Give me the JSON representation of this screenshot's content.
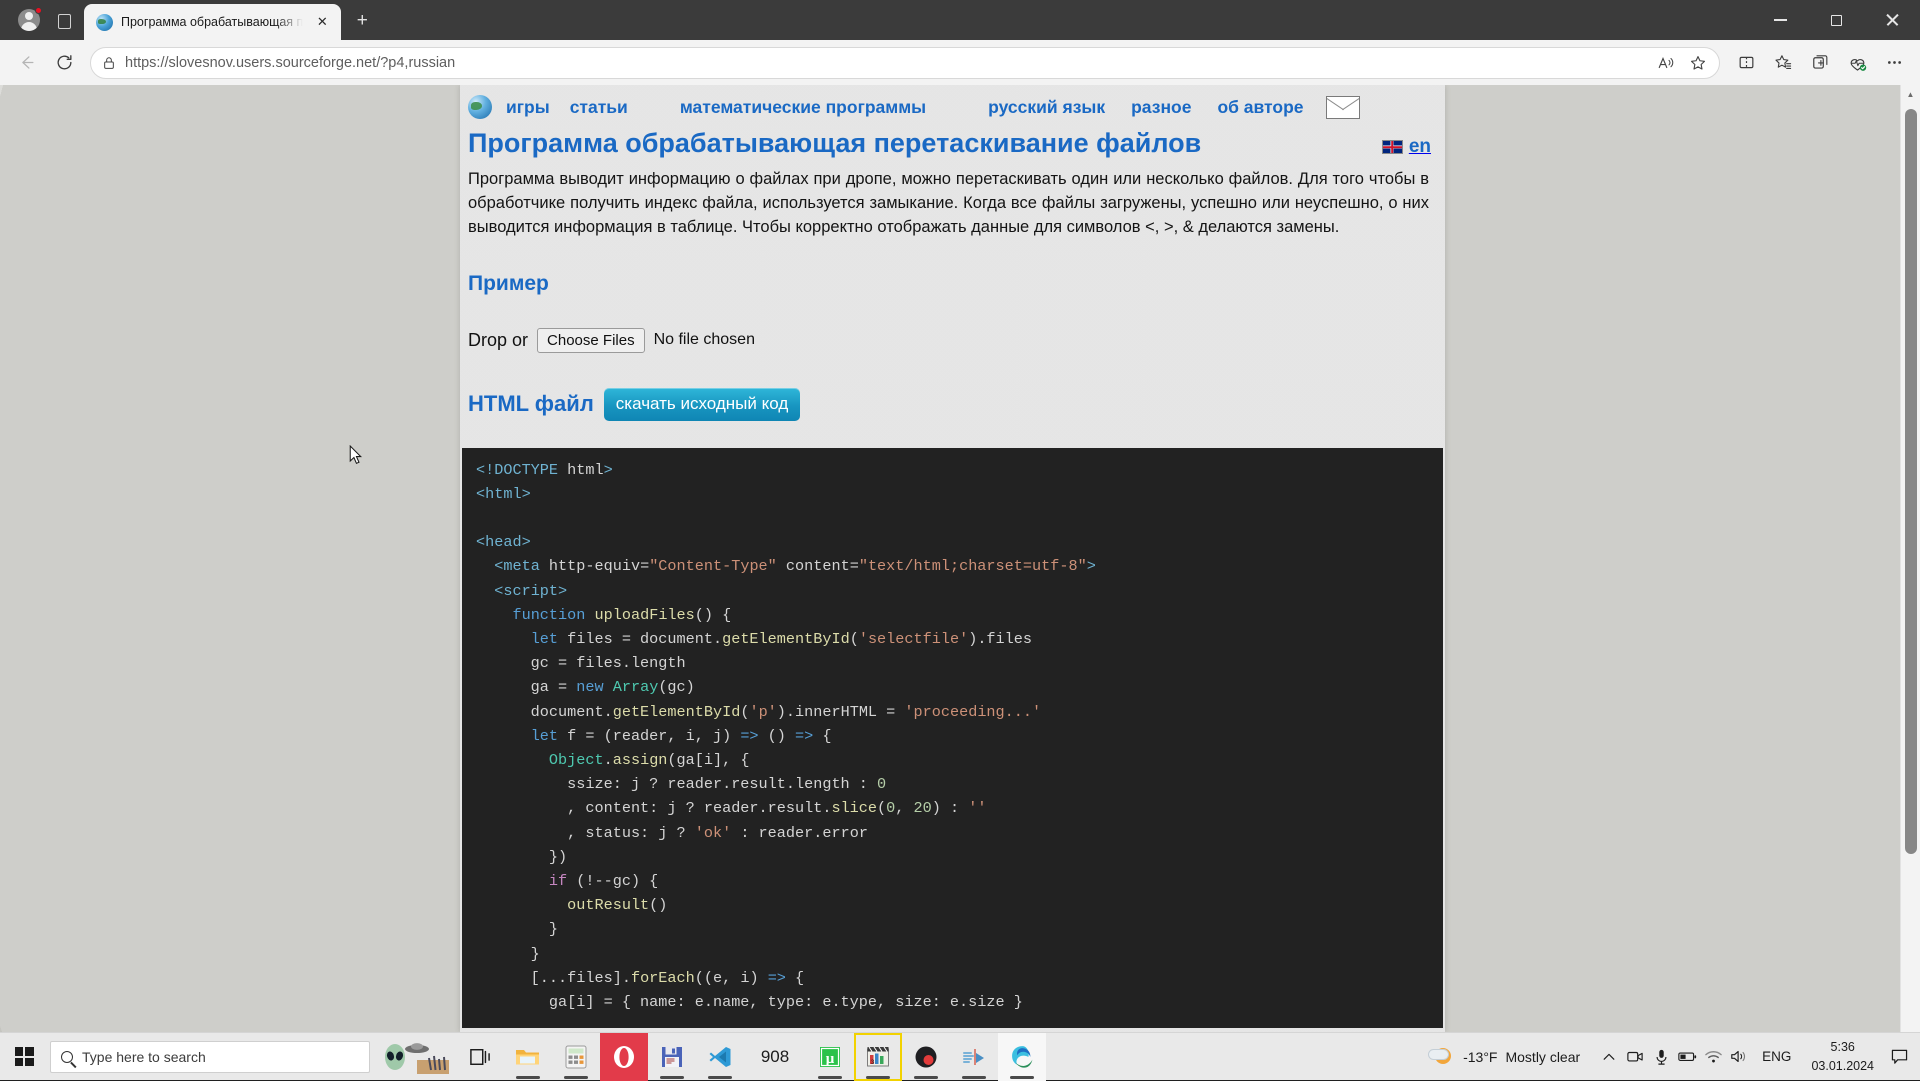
{
  "browser": {
    "tab": {
      "title": "Программа обрабатывающая п",
      "close_label": "✕"
    },
    "newtab_label": "+",
    "url": "https://slovesnov.users.sourceforge.net/?p4,russian",
    "toolbar_icons": {
      "back": "back-arrow-icon",
      "refresh": "refresh-icon",
      "lock": "site-info-lock-icon",
      "read_aloud": "read-aloud-icon",
      "favorite": "add-favorite-star-icon",
      "split_screen": "split-screen-icon",
      "collections_star": "favorites-list-icon",
      "add_collection": "collections-icon",
      "browser_essentials": "browser-essentials-icon",
      "settings": "settings-more-icon"
    },
    "window_controls": {
      "minimize": "minimize",
      "maximize": "maximize",
      "close": "close"
    }
  },
  "page": {
    "nav": [
      {
        "label": "игры",
        "name": "nav-link-games"
      },
      {
        "label": "статьи",
        "name": "nav-link-articles"
      },
      {
        "label": "математические программы",
        "name": "nav-link-math-programs"
      },
      {
        "label": "русский язык",
        "name": "nav-link-russian"
      },
      {
        "label": "разное",
        "name": "nav-link-misc"
      },
      {
        "label": "об авторе",
        "name": "nav-link-about-author"
      }
    ],
    "title": "Программа обрабатывающая перетаскивание файлов",
    "lang_switch": "en",
    "paragraph": "Программа выводит информацию о файлах при дропе, можно перетаскивать один или несколько файлов. Для того чтобы в обработчике получить индекс файла, используется замыкание. Когда все файлы загружены, успешно или неуспешно, о них выводится информация в таблице. Чтобы корректно отображать данные для символов <, >, & делаются замены.",
    "example_heading": "Пример",
    "drop_label": "Drop or",
    "file_button": "Choose Files",
    "file_status": "No file chosen",
    "html_label": "HTML файл",
    "download_button": "скачать исходный код",
    "accent_color": "#1a69c4",
    "download_button_color": "#1895c0"
  },
  "code": {
    "lines": [
      [
        [
          "tok-tag",
          "<!DOCTYPE"
        ],
        [
          "tok-plain",
          " html"
        ],
        [
          "tok-tag",
          ">"
        ]
      ],
      [
        [
          "tok-tag",
          "<html>"
        ]
      ],
      [
        [
          "tok-plain",
          ""
        ]
      ],
      [
        [
          "tok-tag",
          "<head>"
        ]
      ],
      [
        [
          "tok-plain",
          "  "
        ],
        [
          "tok-tag",
          "<meta"
        ],
        [
          "tok-plain",
          " http-equiv="
        ],
        [
          "tok-str",
          "\"Content-Type\""
        ],
        [
          "tok-plain",
          " content="
        ],
        [
          "tok-str",
          "\"text/html;charset=utf-8\""
        ],
        [
          "tok-tag",
          ">"
        ]
      ],
      [
        [
          "tok-plain",
          "  "
        ],
        [
          "tok-tag",
          "<script>"
        ]
      ],
      [
        [
          "tok-plain",
          "    "
        ],
        [
          "tok-kw",
          "function"
        ],
        [
          "tok-plain",
          " "
        ],
        [
          "tok-fn",
          "uploadFiles"
        ],
        [
          "tok-plain",
          "() {"
        ]
      ],
      [
        [
          "tok-plain",
          "      "
        ],
        [
          "tok-kw",
          "let"
        ],
        [
          "tok-plain",
          " files = document."
        ],
        [
          "tok-fn",
          "getElementById"
        ],
        [
          "tok-plain",
          "("
        ],
        [
          "tok-str",
          "'selectfile'"
        ],
        [
          "tok-plain",
          ").files"
        ]
      ],
      [
        [
          "tok-plain",
          "      gc = files.length"
        ]
      ],
      [
        [
          "tok-plain",
          "      ga = "
        ],
        [
          "tok-kw",
          "new"
        ],
        [
          "tok-plain",
          " "
        ],
        [
          "tok-cls",
          "Array"
        ],
        [
          "tok-plain",
          "(gc)"
        ]
      ],
      [
        [
          "tok-plain",
          "      document."
        ],
        [
          "tok-fn",
          "getElementById"
        ],
        [
          "tok-plain",
          "("
        ],
        [
          "tok-str",
          "'p'"
        ],
        [
          "tok-plain",
          ").innerHTML = "
        ],
        [
          "tok-str",
          "'proceeding...'"
        ]
      ],
      [
        [
          "tok-plain",
          "      "
        ],
        [
          "tok-kw",
          "let"
        ],
        [
          "tok-plain",
          " f = (reader, i, j) "
        ],
        [
          "tok-kw",
          "=>"
        ],
        [
          "tok-plain",
          " () "
        ],
        [
          "tok-kw",
          "=>"
        ],
        [
          "tok-plain",
          " {"
        ]
      ],
      [
        [
          "tok-plain",
          "        "
        ],
        [
          "tok-cls",
          "Object"
        ],
        [
          "tok-plain",
          "."
        ],
        [
          "tok-fn",
          "assign"
        ],
        [
          "tok-plain",
          "(ga[i], {"
        ]
      ],
      [
        [
          "tok-plain",
          "          ssize: j ? reader.result.length : "
        ],
        [
          "tok-num",
          "0"
        ]
      ],
      [
        [
          "tok-plain",
          "          , content: j ? reader.result."
        ],
        [
          "tok-fn",
          "slice"
        ],
        [
          "tok-plain",
          "("
        ],
        [
          "tok-num",
          "0"
        ],
        [
          "tok-plain",
          ", "
        ],
        [
          "tok-num",
          "20"
        ],
        [
          "tok-plain",
          ") : "
        ],
        [
          "tok-str",
          "''"
        ]
      ],
      [
        [
          "tok-plain",
          "          , status: j ? "
        ],
        [
          "tok-str",
          "'ok'"
        ],
        [
          "tok-plain",
          " : reader.error"
        ]
      ],
      [
        [
          "tok-plain",
          "        })"
        ]
      ],
      [
        [
          "tok-plain",
          "        "
        ],
        [
          "tok-kw2",
          "if"
        ],
        [
          "tok-plain",
          " (!--gc) {"
        ]
      ],
      [
        [
          "tok-plain",
          "          "
        ],
        [
          "tok-fn",
          "outResult"
        ],
        [
          "tok-plain",
          "()"
        ]
      ],
      [
        [
          "tok-plain",
          "        }"
        ]
      ],
      [
        [
          "tok-plain",
          "      }"
        ]
      ],
      [
        [
          "tok-plain",
          "      [...files]."
        ],
        [
          "tok-fn",
          "forEach"
        ],
        [
          "tok-plain",
          "((e, i) "
        ],
        [
          "tok-kw",
          "=>"
        ],
        [
          "tok-plain",
          " {"
        ]
      ],
      [
        [
          "tok-plain",
          "        ga[i] = { name: e.name, type: e.type, size: e.size }"
        ]
      ]
    ]
  },
  "taskbar": {
    "search_placeholder": "Type here to search",
    "icons": [
      {
        "name": "taskview-icon",
        "label": ""
      },
      {
        "name": "file-explorer-icon",
        "label": ""
      },
      {
        "name": "calculator-icon",
        "label": ""
      },
      {
        "name": "opera-icon",
        "label": ""
      },
      {
        "name": "save-app-icon",
        "label": ""
      },
      {
        "name": "vscode-icon",
        "label": ""
      },
      {
        "name": "counter-icon",
        "label": "908"
      },
      {
        "name": "utorrent-icon",
        "label": ""
      },
      {
        "name": "movie-maker-icon",
        "label": ""
      },
      {
        "name": "obs-studio-icon",
        "label": ""
      },
      {
        "name": "media-player-icon",
        "label": ""
      },
      {
        "name": "edge-icon",
        "label": ""
      }
    ],
    "weather": {
      "temperature": "-13°F",
      "condition": "Mostly clear"
    },
    "tray": [
      "show-hidden-icons",
      "camera-icon",
      "microphone-icon",
      "battery-icon",
      "wifi-icon",
      "volume-icon"
    ],
    "language": "ENG",
    "time": "5:36",
    "date": "03.01.2024"
  }
}
